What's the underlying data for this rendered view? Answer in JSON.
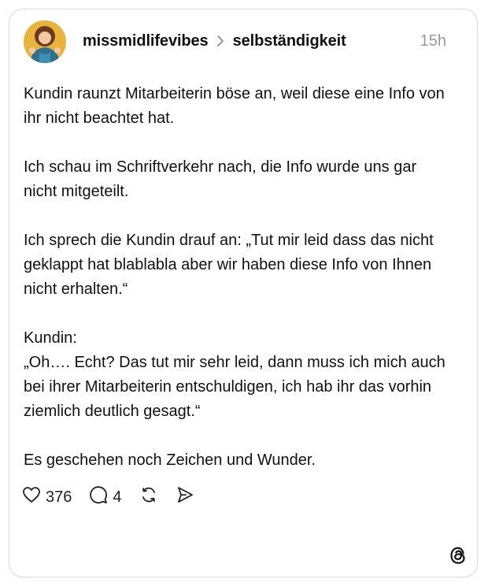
{
  "post": {
    "username": "missmidlifevibes",
    "community": "selbständigkeit",
    "timestamp": "15h",
    "paragraphs": [
      "Kundin raunzt Mitarbeiterin böse an, weil diese eine Info von ihr nicht beachtet hat.",
      "Ich schau im Schriftverkehr nach, die Info wurde uns gar nicht mitgeteilt.",
      "Ich sprech die Kundin drauf an: „Tut mir leid dass das nicht geklappt hat blablabla aber wir haben diese Info von Ihnen nicht erhalten.“",
      "Kundin:\n„Oh…. Echt? Das tut mir sehr leid, dann muss ich mich auch bei ihrer Mitarbeiterin entschuldigen, ich hab ihr das vorhin ziemlich deutlich gesagt.“",
      "Es geschehen noch Zeichen und Wunder."
    ]
  },
  "actions": {
    "like_count": "376",
    "reply_count": "4"
  },
  "icons": {
    "like": "heart-icon",
    "reply": "comment-icon",
    "repost": "repost-icon",
    "share": "send-icon",
    "brand": "threads-logo-icon",
    "separator": "chevron-right-icon"
  },
  "colors": {
    "text": "#111111",
    "muted": "#999999",
    "border": "#d9d9d9"
  }
}
